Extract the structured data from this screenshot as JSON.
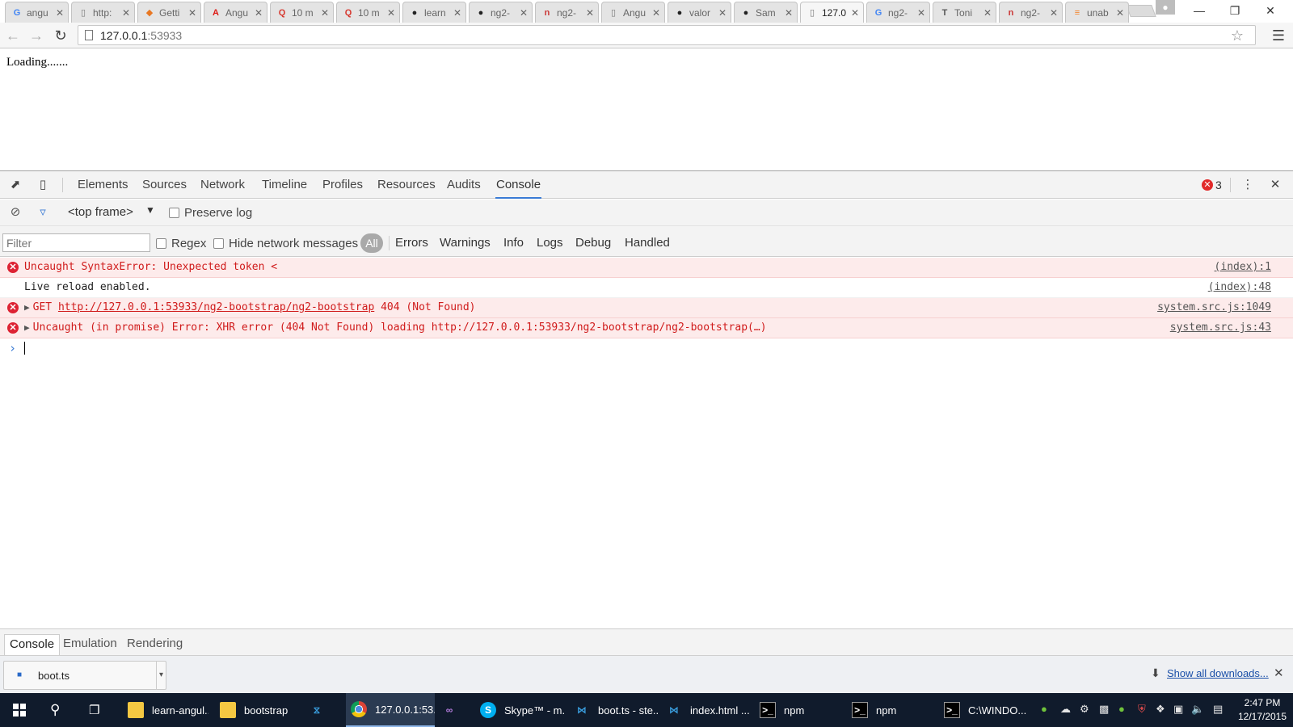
{
  "browser": {
    "tabs": [
      {
        "title": "angu",
        "icon": "google-icon",
        "icon_char": "G",
        "icon_color": "#4285f4",
        "active": false
      },
      {
        "title": "http:",
        "icon": "page-icon",
        "icon_char": "▯",
        "icon_color": "#777777",
        "active": false
      },
      {
        "title": "Getti",
        "icon": "diamond-icon",
        "icon_char": "◆",
        "icon_color": "#e87722",
        "active": false
      },
      {
        "title": "Angu",
        "icon": "angular-shield-icon",
        "icon_char": "A",
        "icon_color": "#dd1b16",
        "active": false
      },
      {
        "title": "10 m",
        "icon": "q-icon",
        "icon_char": "Q",
        "icon_color": "#d6382f",
        "active": false
      },
      {
        "title": "10 m",
        "icon": "q-icon",
        "icon_char": "Q",
        "icon_color": "#d6382f",
        "active": false
      },
      {
        "title": "learn",
        "icon": "github-icon",
        "icon_char": "●",
        "icon_color": "#222222",
        "active": false
      },
      {
        "title": "ng2-",
        "icon": "github-icon",
        "icon_char": "●",
        "icon_color": "#222222",
        "active": false
      },
      {
        "title": "ng2-",
        "icon": "npm-icon",
        "icon_char": "n",
        "icon_color": "#cb3837",
        "active": false
      },
      {
        "title": "Angu",
        "icon": "page-icon",
        "icon_char": "▯",
        "icon_color": "#777777",
        "active": false
      },
      {
        "title": "valor",
        "icon": "github-icon",
        "icon_char": "●",
        "icon_color": "#222222",
        "active": false
      },
      {
        "title": "Sam",
        "icon": "github-icon",
        "icon_char": "●",
        "icon_color": "#222222",
        "active": false
      },
      {
        "title": "127.0",
        "icon": "page-icon",
        "icon_char": "▯",
        "icon_color": "#777777",
        "active": true
      },
      {
        "title": "ng2-",
        "icon": "google-icon",
        "icon_char": "G",
        "icon_color": "#4285f4",
        "active": false
      },
      {
        "title": "Toni",
        "icon": "t-icon",
        "icon_char": "T",
        "icon_color": "#555555",
        "active": false
      },
      {
        "title": "ng2-",
        "icon": "npm-icon",
        "icon_char": "n",
        "icon_color": "#cb3837",
        "active": false
      },
      {
        "title": "unab",
        "icon": "stack-icon",
        "icon_char": "≡",
        "icon_color": "#f48024",
        "active": false
      }
    ],
    "url_host": "127.0.0.1",
    "url_port": ":53933"
  },
  "page": {
    "loading_text": "Loading......."
  },
  "devtools": {
    "tabs": [
      "Elements",
      "Sources",
      "Network",
      "Timeline",
      "Profiles",
      "Resources",
      "Audits",
      "Console"
    ],
    "active_tab": "Console",
    "error_count": "3",
    "frame_select": "<top frame>",
    "preserve_log_label": "Preserve log",
    "filter_placeholder": "Filter",
    "regex_label": "Regex",
    "hide_network_label": "Hide network messages",
    "levels": [
      "All",
      "Errors",
      "Warnings",
      "Info",
      "Logs",
      "Debug",
      "Handled"
    ],
    "messages": [
      {
        "type": "error",
        "expandable": false,
        "text": "Uncaught SyntaxError: Unexpected token <",
        "source": "(index):1"
      },
      {
        "type": "log",
        "expandable": false,
        "text": "Live reload enabled.",
        "source": "(index):48"
      },
      {
        "type": "error",
        "expandable": true,
        "prefix": "GET ",
        "link": "http://127.0.0.1:53933/ng2-bootstrap/ng2-bootstrap",
        "suffix": " 404 (Not Found)",
        "source": "system.src.js:1049"
      },
      {
        "type": "error",
        "expandable": true,
        "text": "Uncaught (in promise) Error: XHR error (404 Not Found) loading http://127.0.0.1:53933/ng2-bootstrap/ng2-bootstrap(…)",
        "source": "system.src.js:43"
      }
    ],
    "drawer_tabs": [
      "Console",
      "Emulation",
      "Rendering"
    ],
    "drawer_active": "Console"
  },
  "downloads": {
    "file_name": "boot.ts",
    "show_all_label": "Show all downloads..."
  },
  "taskbar": {
    "items": [
      {
        "label": "learn-angul...",
        "icon": "folder-icon",
        "active": false
      },
      {
        "label": "bootstrap",
        "icon": "folder-icon",
        "active": false
      },
      {
        "label": "",
        "icon": "app-icon",
        "active": false
      },
      {
        "label": "127.0.0.1:53...",
        "icon": "chrome-icon",
        "active": true
      },
      {
        "label": "",
        "icon": "visual-studio-icon",
        "active": false
      },
      {
        "label": "Skype™ - m...",
        "icon": "skype-icon",
        "active": false
      },
      {
        "label": "boot.ts - ste...",
        "icon": "vscode-icon",
        "active": false
      },
      {
        "label": "index.html ...",
        "icon": "vscode-icon",
        "active": false
      },
      {
        "label": "npm",
        "icon": "cmd-icon",
        "active": false
      },
      {
        "label": "npm",
        "icon": "cmd-icon",
        "active": false
      },
      {
        "label": "C:\\WINDO...",
        "icon": "cmd-icon",
        "active": false
      }
    ],
    "time": "2:47 PM",
    "date": "12/17/2015"
  }
}
